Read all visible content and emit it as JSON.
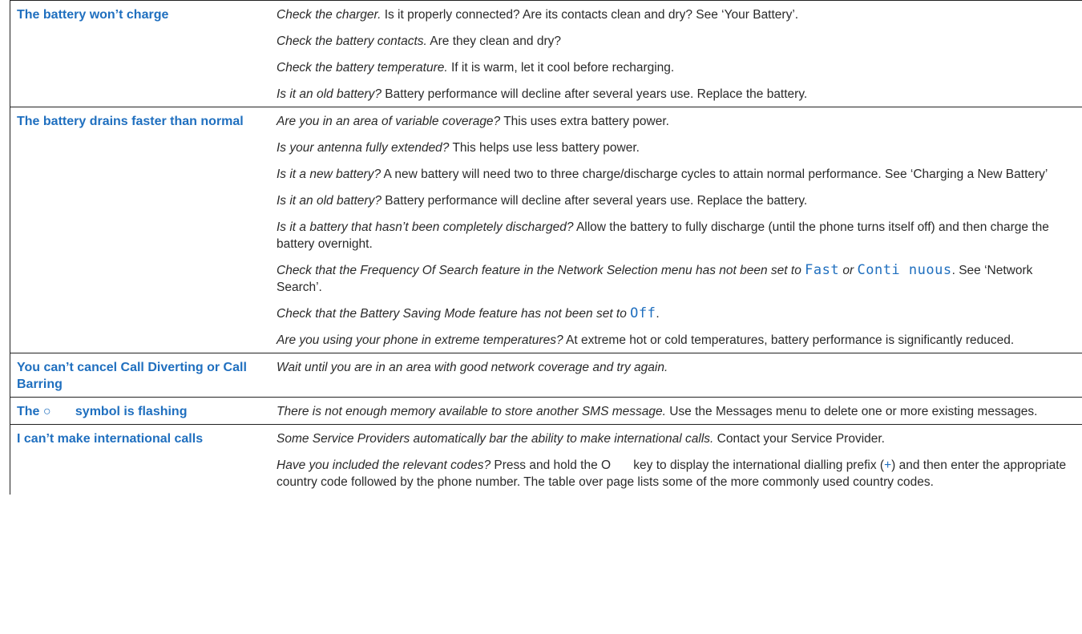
{
  "rows": [
    {
      "problem": "The battery won’t charge",
      "solutions": [
        {
          "q": "Check the charger.",
          "t": " Is it properly connected? Are its contacts clean and dry? See ‘Your Battery’."
        },
        {
          "q": "Check the battery contacts.",
          "t": " Are they clean and dry?"
        },
        {
          "q": "Check the battery temperature.",
          "t": " If it is warm, let it cool before recharging."
        },
        {
          "q": "Is it an old battery?",
          "t": " Battery performance will decline after several years use. Replace the battery."
        }
      ]
    },
    {
      "problem": "The battery drains faster than normal",
      "solutions": [
        {
          "q": "Are you in an area of variable coverage?",
          "t": " This uses extra battery power."
        },
        {
          "q": "Is your antenna fully extended?",
          "t": " This helps use less battery power."
        },
        {
          "q": "Is it a new battery?",
          "t": " A new battery will need two to three charge/discharge cycles to attain normal performance. See ‘Charging a New Battery’"
        },
        {
          "q": "Is it an old battery?",
          "t": " Battery performance will decline after several years use. Replace the battery."
        },
        {
          "q": "Is it a battery that hasn’t been completely discharged?",
          "t": " Allow the battery to fully discharge (until the phone turns itself off) and then charge the battery overnight."
        }
      ],
      "freq": {
        "pre": "Check that the Frequency Of Search feature in the Network Selection menu has not been set to ",
        "fast": "Fast",
        "or": " or ",
        "cont": "Conti nuous",
        "post": ". See ‘Network Search’."
      },
      "saving": {
        "pre": "Check that the Battery Saving Mode feature has not been set to ",
        "off": "Off",
        "post": "."
      },
      "extreme": {
        "q": "Are you using your phone in extreme temperatures?",
        "t": " At extreme hot or cold temperatures, battery performance is significantly reduced."
      }
    },
    {
      "problem": "You can’t cancel Call Diverting or Call Barring",
      "solutions": [
        {
          "q": "Wait until you are in an area with good network coverage and try again.",
          "t": ""
        }
      ]
    },
    {
      "problem_pre": "The ",
      "problem_sym": "○",
      "problem_post": "symbol is flashing",
      "solutions": [
        {
          "q": "There is not enough memory available to store another SMS message.",
          "t": " Use the Messages menu to delete one or more existing messages."
        }
      ]
    },
    {
      "problem": "I can’t make international calls",
      "solutions": [
        {
          "q": "Some Service Providers automatically bar the ability to make international calls.",
          "t": " Contact your Service Provider."
        }
      ],
      "codes": {
        "q": "Have you included the relevant codes?",
        "pre": " Press and hold the ",
        "key": "O",
        "mid": " key to display the international dialling prefix (",
        "plus": "+",
        "post": ") and then enter the appropriate country code followed by the phone number. The table over page lists some of the more commonly used country codes."
      }
    }
  ]
}
